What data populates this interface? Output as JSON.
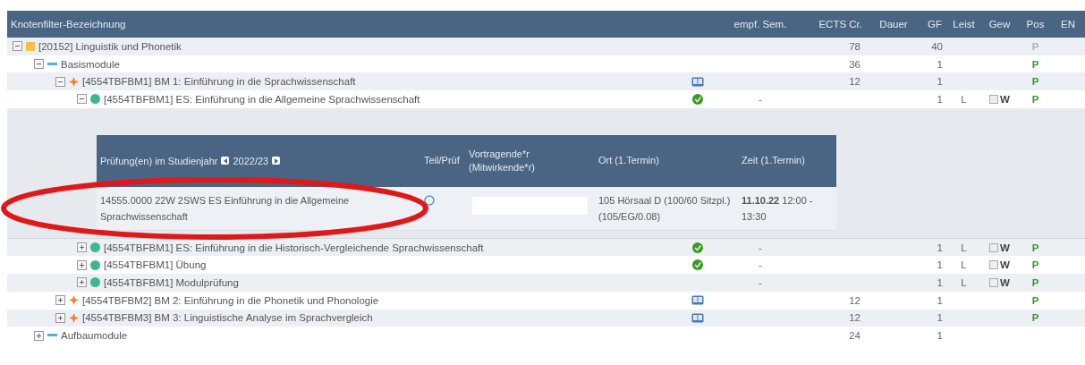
{
  "columns": [
    "Knotenfilter-Bezeichnung",
    "",
    "empf. Sem.",
    "ECTS Cr.",
    "Dauer",
    "GF",
    "Leist",
    "Gew",
    "Pos",
    "EN"
  ],
  "tree": [
    {
      "label": "[20152] Linguistik und Phonetik",
      "kind": "square",
      "expanded": true,
      "ects": "78",
      "gf": "40",
      "pos": {
        "text": "P",
        "disabled": true
      },
      "children": [
        {
          "label": "Basismodule",
          "kind": "dash",
          "expanded": true,
          "ects": "36",
          "gf": "1",
          "pos": {
            "text": "P",
            "disabled": false
          },
          "children": [
            {
              "label": "[4554TBFBM1] BM 1: Einführung in die Sprachwissenschaft",
              "kind": "cross",
              "expanded": true,
              "info": true,
              "ects": "12",
              "gf": "1",
              "pos": {
                "text": "P",
                "disabled": false
              },
              "children": [
                {
                  "label": "[4554TBFBM1] ES: Einführung in die Allgemeine Sprachwissenschaft",
                  "kind": "dot",
                  "expanded": true,
                  "passed": true,
                  "empf": "-",
                  "gf": "1",
                  "leist": "L",
                  "gew": {
                    "text": "W",
                    "checked": false
                  },
                  "pos": {
                    "text": "P",
                    "disabled": false
                  },
                  "exam_panel": {
                    "title": "Prüfung(en) im Studienjahr",
                    "year": "2022/23",
                    "columns": [
                      "Teil/Prüf",
                      "Vortragende*r (Mitwirkende*r)",
                      "Ort (1.Termin)",
                      "Zeit (1.Termin)"
                    ],
                    "rows": [
                      {
                        "course": "14555.0000 22W 2SWS ES Einführung in die Allgemeine Sprachwissenschaft",
                        "ort": "105 Hörsaal D (100/60 Sitzpl.) (105/EG/0.08)",
                        "zeit": "**11.10.22** 12:00 - 13:30"
                      }
                    ]
                  }
                },
                {
                  "label": "[4554TBFBM1] ES: Einführung in die Historisch-Vergleichende Sprachwissenschaft",
                  "kind": "dot",
                  "expanded": false,
                  "passed": true,
                  "empf": "-",
                  "gf": "1",
                  "leist": "L",
                  "gew": {
                    "text": "W",
                    "checked": false
                  },
                  "pos": {
                    "text": "P",
                    "disabled": false
                  }
                },
                {
                  "label": "[4554TBFBM1] Übung",
                  "kind": "dot",
                  "expanded": false,
                  "passed": true,
                  "empf": "-",
                  "gf": "1",
                  "leist": "L",
                  "gew": {
                    "text": "W",
                    "checked": false
                  },
                  "pos": {
                    "text": "P",
                    "disabled": false
                  }
                },
                {
                  "label": "[4554TBFBM1] Modulprüfung",
                  "kind": "dot",
                  "expanded": false,
                  "empf": "-",
                  "gf": "1",
                  "leist": "L",
                  "gew": {
                    "text": "W",
                    "checked": false
                  },
                  "pos": {
                    "text": "P",
                    "disabled": false
                  }
                }
              ]
            },
            {
              "label": "[4554TBFBM2] BM 2: Einführung in die Phonetik und Phonologie",
              "kind": "cross",
              "expanded": false,
              "info": true,
              "ects": "12",
              "gf": "1",
              "pos": {
                "text": "P",
                "disabled": false
              }
            },
            {
              "label": "[4554TBFBM3] BM 3: Linguistische Analyse im Sprachvergleich",
              "kind": "cross",
              "expanded": false,
              "info": true,
              "ects": "12",
              "gf": "1",
              "pos": {
                "text": "P",
                "disabled": false
              }
            }
          ]
        },
        {
          "label": "Aufbaumodule",
          "kind": "dash",
          "expanded": false,
          "ects": "24",
          "gf": "1"
        }
      ]
    }
  ]
}
